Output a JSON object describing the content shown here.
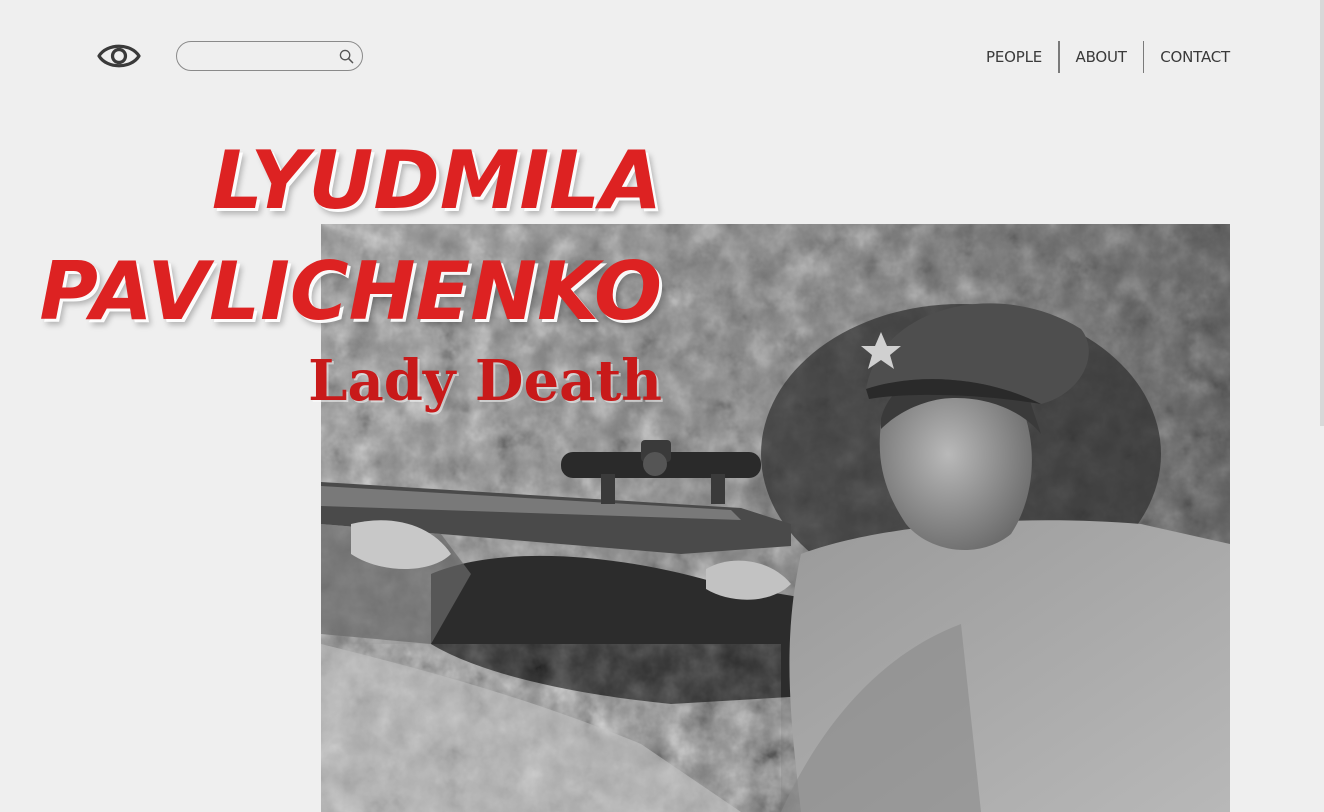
{
  "header": {
    "logo_icon": "eye-icon",
    "search": {
      "value": "",
      "placeholder": "",
      "icon": "search-icon"
    },
    "nav": [
      {
        "label": "PEOPLE"
      },
      {
        "label": "ABOUT"
      },
      {
        "label": "CONTACT"
      }
    ]
  },
  "hero": {
    "title_line1": "LYUDMILA",
    "title_line2": "PAVLICHENKO",
    "subtitle": "Lady Death"
  },
  "colors": {
    "background": "#efefef",
    "title_red": "#dd2222",
    "subtitle_red": "#c81a1a",
    "nav_text": "#3a3a3a"
  }
}
